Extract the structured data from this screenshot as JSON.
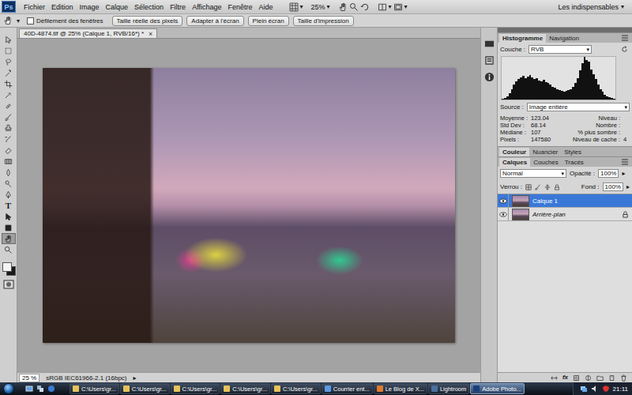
{
  "app": {
    "logo": "Ps",
    "arrow": "▾",
    "zoom": "25%",
    "workspace": "Les indispensables"
  },
  "menu": [
    "Fichier",
    "Edition",
    "Image",
    "Calque",
    "Sélection",
    "Filtre",
    "Affichage",
    "Fenêtre",
    "Aide"
  ],
  "options_bar": {
    "scroll_all": {
      "label": "Défilement des fenêtres",
      "checked": false
    },
    "buttons": [
      "Taille réelle des pixels",
      "Adapter à l'écran",
      "Plein écran",
      "Taille d'impression"
    ]
  },
  "document": {
    "title": "40D-4874.tif @ 25% (Calque 1, RVB/16*) *",
    "close": "×"
  },
  "tools": [
    {
      "kind": "move",
      "selected": false
    },
    {
      "kind": "marquee",
      "selected": false
    },
    {
      "kind": "lasso",
      "selected": false
    },
    {
      "kind": "wand",
      "selected": false
    },
    {
      "kind": "crop",
      "selected": false
    },
    {
      "kind": "eyedropper",
      "selected": false
    },
    {
      "kind": "heal",
      "selected": false
    },
    {
      "kind": "brush",
      "selected": false
    },
    {
      "kind": "stamp",
      "selected": false
    },
    {
      "kind": "history",
      "selected": false
    },
    {
      "kind": "eraser",
      "selected": false
    },
    {
      "kind": "gradient",
      "selected": false
    },
    {
      "kind": "blur",
      "selected": false
    },
    {
      "kind": "dodge",
      "selected": false
    },
    {
      "kind": "pen",
      "selected": false
    },
    {
      "kind": "type",
      "glyph": "T",
      "selected": false
    },
    {
      "kind": "path",
      "selected": false
    },
    {
      "kind": "shape",
      "selected": false
    },
    {
      "kind": "hand",
      "selected": true
    },
    {
      "kind": "zoom",
      "selected": false
    }
  ],
  "swatches": {
    "foreground": "#f4f4f4",
    "background": "#1a1a1a"
  },
  "status_bar": {
    "zoom": "25 %",
    "profile": "sRGB IEC61966-2.1 (16bpc)",
    "arrow": "▸"
  },
  "histogram_panel": {
    "tabs": [
      {
        "label": "Histogramme",
        "selected": true
      },
      {
        "label": "Navigation",
        "selected": false
      }
    ],
    "channel_label": "Couche :",
    "channel": "RVB",
    "values": [
      2,
      4,
      8,
      15,
      25,
      35,
      42,
      48,
      52,
      55,
      50,
      54,
      58,
      52,
      48,
      50,
      45,
      42,
      46,
      40,
      38,
      35,
      30,
      28,
      25,
      22,
      20,
      18,
      20,
      22,
      25,
      30,
      38,
      50,
      68,
      85,
      100,
      92,
      88,
      70,
      60,
      48,
      35,
      25,
      18,
      12,
      8,
      5,
      3,
      2
    ],
    "source_label": "Source :",
    "source": "Image entière",
    "stats_left": [
      {
        "label": "Moyenne :",
        "value": "123.04"
      },
      {
        "label": "Std Dev :",
        "value": "68.14"
      },
      {
        "label": "Médiane :",
        "value": "107"
      },
      {
        "label": "Pixels :",
        "value": "147580"
      }
    ],
    "stats_right": [
      {
        "label": "Niveau :"
      },
      {
        "label": "Nombre :"
      },
      {
        "label": "% plus sombre :"
      },
      {
        "label": "Niveau de cache :",
        "value": "4"
      }
    ]
  },
  "color_panel": {
    "tabs": [
      {
        "label": "Couleur",
        "selected": true
      },
      {
        "label": "Nuancier",
        "selected": false
      },
      {
        "label": "Styles",
        "selected": false
      }
    ]
  },
  "layers_panel": {
    "tabs": [
      {
        "label": "Calques",
        "selected": true
      },
      {
        "label": "Couches",
        "selected": false
      },
      {
        "label": "Tracés",
        "selected": false
      }
    ],
    "blend_mode": "Normal",
    "opacity_label": "Opacité :",
    "opacity": "100%",
    "lock_label": "Verrou :",
    "fill_label": "Fond :",
    "fill": "100%",
    "slider_arrow": "▸",
    "fx_label": "fx",
    "layers": [
      {
        "name": "Calque 1",
        "kind": "layer",
        "selected": true,
        "visible": true,
        "locked": false
      },
      {
        "name": "Arrière-plan",
        "kind": "background",
        "selected": false,
        "visible": true,
        "locked": true
      }
    ]
  },
  "taskbar": {
    "tasks": [
      {
        "label": "C:\\Users\\gr...",
        "kind": "folder",
        "selected": false
      },
      {
        "label": "C:\\Users\\gr...",
        "kind": "folder",
        "selected": false
      },
      {
        "label": "C:\\Users\\gr...",
        "kind": "folder",
        "selected": false
      },
      {
        "label": "C:\\Users\\gr...",
        "kind": "folder",
        "selected": false
      },
      {
        "label": "C:\\Users\\gr...",
        "kind": "folder",
        "selected": false
      },
      {
        "label": "Courrier ent...",
        "kind": "mail",
        "selected": false
      },
      {
        "label": "Le Blog de X...",
        "kind": "browser",
        "selected": false
      },
      {
        "label": "Lightroom",
        "kind": "lightroom",
        "selected": false
      },
      {
        "label": "Adobe Photo...",
        "kind": "photoshop",
        "selected": true
      }
    ],
    "clock": "21:11"
  }
}
